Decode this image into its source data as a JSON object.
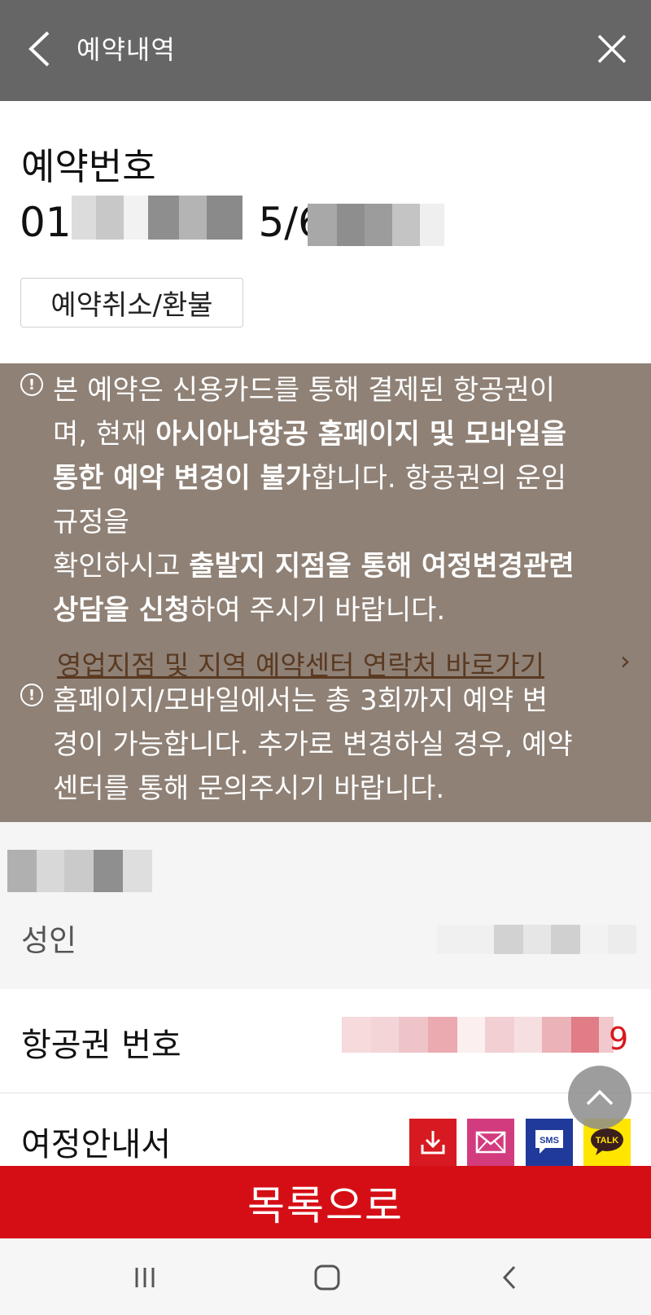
{
  "header": {
    "title": "예약내역",
    "back_icon": "chevron-left-icon",
    "close_icon": "close-icon"
  },
  "reservation": {
    "label": "예약번호",
    "number_visible_start": "01",
    "number_visible_mid": "5/6I",
    "cancel_button": "예약취소/환불"
  },
  "notice": {
    "para1_line1": "본 예약은 신용카드를 통해 결제된 항공권이",
    "para1_line2_normal": "며, 현재 ",
    "para1_line2_bold": "아시아나항공 홈페이지 및 모바일을",
    "para1_line3_bold": "통한 예약 변경이 불가",
    "para1_line3_normal": "합니다. 항공권의 운임",
    "para1_line4": "규정을",
    "para1_line5_normal": "확인하시고 ",
    "para1_line5_bold": "출발지 지점을 통해 여정변경관련",
    "para1_line6_bold": "상담을 신청",
    "para1_line6_normal": "하여 주시기 바랍니다.",
    "link_text": "영업지점 및 지역 예약센터 연락처 바로가기",
    "link_arrow": "›",
    "para2_line1": "홈페이지/모바일에서는 총 3회까지 예약 변",
    "para2_line2": "경이 가능합니다. 추가로 변경하실 경우, 예약",
    "para2_line3": "센터를 통해 문의주시기 바랍니다."
  },
  "passenger": {
    "type": "성인"
  },
  "ticket": {
    "label": "항공권 번호",
    "visible_tail": "9"
  },
  "itinerary": {
    "label": "여정안내서",
    "buttons": [
      {
        "name": "download",
        "icon": "download-icon",
        "label": ""
      },
      {
        "name": "email",
        "icon": "mail-icon",
        "label": ""
      },
      {
        "name": "sms",
        "icon": "sms-icon",
        "label": "SMS"
      },
      {
        "name": "kakaotalk",
        "icon": "talk-icon",
        "label": "TALK"
      }
    ]
  },
  "bottom": {
    "list_button": "목록으로"
  },
  "colors": {
    "header_bg": "#666666",
    "notice_bg": "#8f8176",
    "accent_red": "#d50e16",
    "link_brown": "#5a3a22"
  }
}
